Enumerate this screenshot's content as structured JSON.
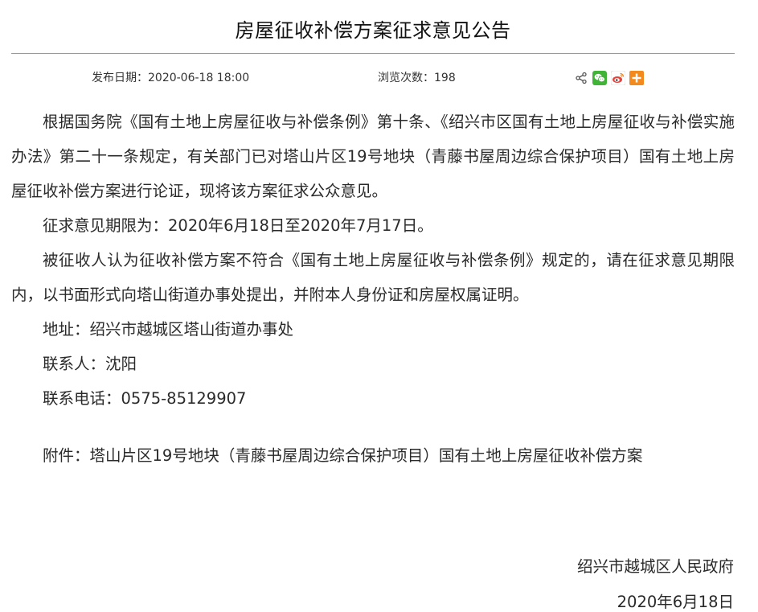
{
  "header": {
    "title": "房屋征收补偿方案征求意见公告"
  },
  "meta": {
    "publish_label": "发布日期：2020-06-18 18:00",
    "views_label": "浏览次数：198"
  },
  "share": {
    "icons": [
      "share-icon",
      "wechat-icon",
      "weibo-icon",
      "more-share-icon"
    ],
    "colors": {
      "share": "#555555",
      "wechat": "#3fb436",
      "weibo": "#e5443d",
      "more": "#f28a1e"
    }
  },
  "body": {
    "p1": "根据国务院《国有土地上房屋征收与补偿条例》第十条、《绍兴市区国有土地上房屋征收与补偿实施办法》第二十一条规定，有关部门已对塔山片区19号地块（青藤书屋周边综合保护项目）国有土地上房屋征收补偿方案进行论证，现将该方案征求公众意见。",
    "p2": "征求意见期限为：2020年6月18日至2020年7月17日。",
    "p3": "被征收人认为征收补偿方案不符合《国有土地上房屋征收与补偿条例》规定的，请在征求意见期限内，以书面形式向塔山街道办事处提出，并附本人身份证和房屋权属证明。",
    "address": "地址：绍兴市越城区塔山街道办事处",
    "contact": "联系人：沈阳",
    "phone": "联系电话：0575-85129907",
    "attachment": "附件：塔山片区19号地块（青藤书屋周边综合保护项目）国有土地上房屋征收补偿方案"
  },
  "signature": {
    "org": "绍兴市越城区人民政府",
    "date": "2020年6月18日"
  }
}
